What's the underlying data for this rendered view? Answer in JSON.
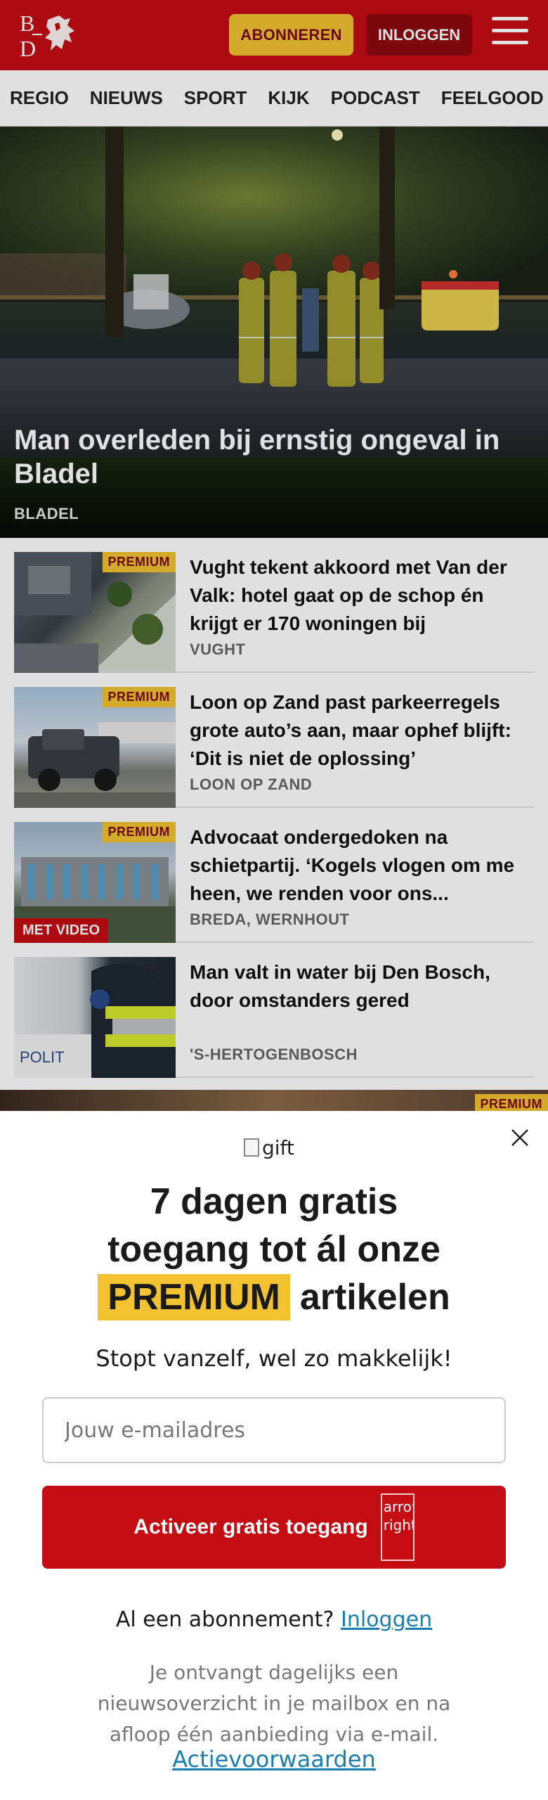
{
  "header": {
    "logo_text": "BD",
    "subscribe_label": "ABONNEREN",
    "login_label": "INLOGGEN",
    "menu_icon": "hamburger-icon",
    "brand_color": "#c40c13",
    "accent_color": "#f2c230"
  },
  "nav": {
    "items": [
      "REGIO",
      "NIEUWS",
      "SPORT",
      "KIJK",
      "PODCAST",
      "FEELGOOD"
    ],
    "more": "I"
  },
  "hero": {
    "title": "Man overleden bij ernstig ongeval in Bladel",
    "location": "BLADEL"
  },
  "articles": [
    {
      "title": "Vught tekent akkoord met Van der Valk: hotel gaat op de schop én krijgt er 170 woningen bij",
      "location": "VUGHT",
      "premium": "PREMIUM",
      "video": ""
    },
    {
      "title": "Loon op Zand past parkeerregels grote auto’s aan, maar ophef blijft: ‘Dit is niet de oplossing’",
      "location": "LOON OP ZAND",
      "premium": "PREMIUM",
      "video": ""
    },
    {
      "title": "Advocaat ondergedoken na schietpartij. ‘Kogels vlogen om me heen, we renden voor ons...",
      "location": "BREDA, WERNHOUT",
      "premium": "PREMIUM",
      "video": "MET VIDEO"
    },
    {
      "title": "Man valt in water bij Den Bosch, door omstanders gered",
      "location": "'S-HERTOGENBOSCH",
      "premium": "",
      "video": ""
    }
  ],
  "next_strip": {
    "premium": "PREMIUM"
  },
  "modal": {
    "gift_alt": "gift",
    "title_line1": "7 dagen gratis",
    "title_line2": "toegang tot ál onze",
    "title_premium": "PREMIUM",
    "title_tail": "artikelen",
    "subtitle": "Stopt vanzelf, wel zo makkelijk!",
    "email_placeholder": "Jouw e-mailadres",
    "activate_label": "Activeer gratis toegang",
    "arrow_alt": "arrow right",
    "has_sub_text": "Al een abonnement?",
    "has_sub_link": "Inloggen",
    "info": "Je ontvangt dagelijks een nieuwsoverzicht in je mailbox en na afloop één aanbieding via e-mail.",
    "terms": "Actievoorwaarden",
    "close_icon": "close-icon"
  }
}
